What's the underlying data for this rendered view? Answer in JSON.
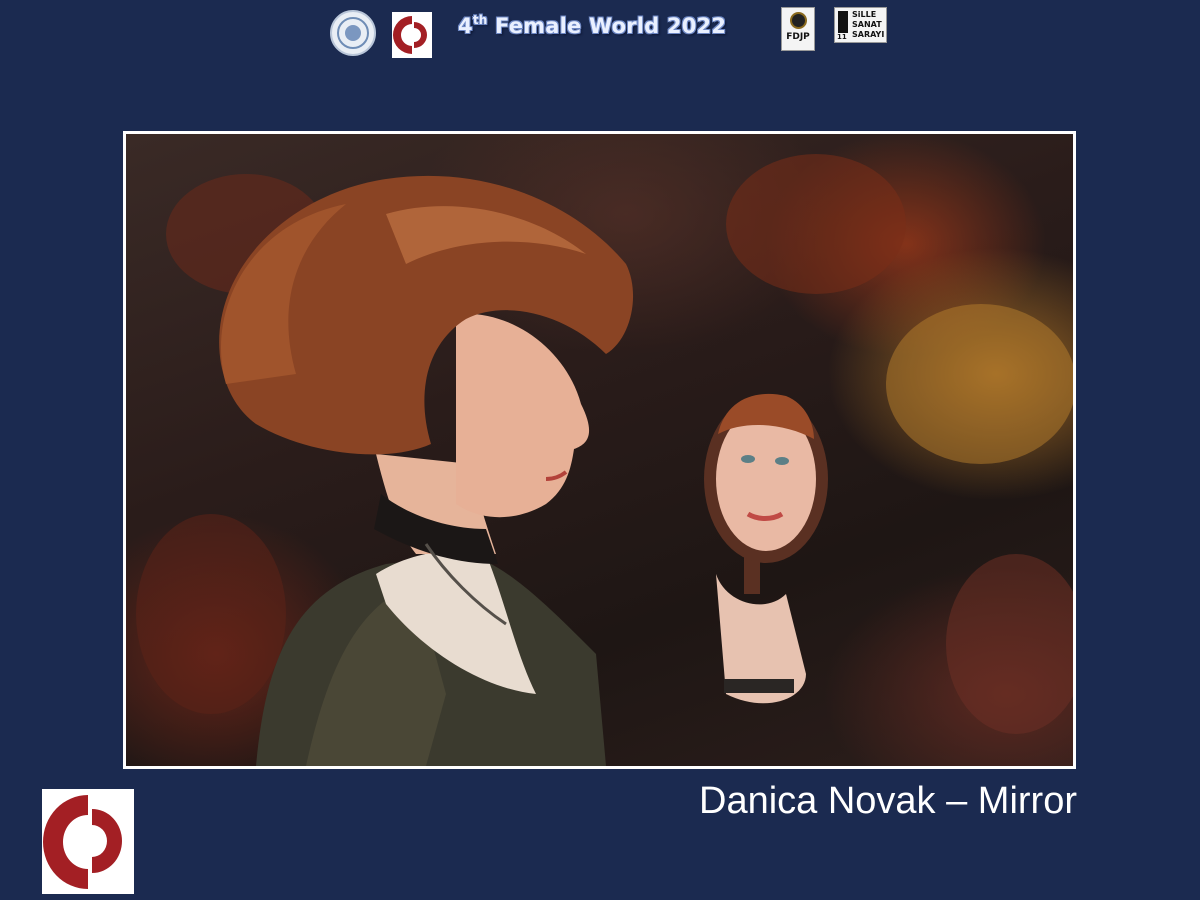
{
  "header": {
    "title_main": "4",
    "title_sup": "th",
    "title_rest": " Female World 2022",
    "logos": [
      {
        "name": "salon-seal-logo"
      },
      {
        "name": "organizer-red-logo"
      },
      {
        "name": "fdjp-logo",
        "text": "FDJP"
      },
      {
        "name": "sille-sanat-sarayi-logo",
        "lines": [
          "SiLLE",
          "SANAT",
          "SARAYI"
        ],
        "number": "11"
      }
    ]
  },
  "photo": {
    "subject": "woman-with-hand-mirror"
  },
  "caption": {
    "text": "Danica Novak – Mirror"
  },
  "colors": {
    "background": "#1b2a50",
    "frame": "#ffffff",
    "logo_red": "#a31f24"
  }
}
